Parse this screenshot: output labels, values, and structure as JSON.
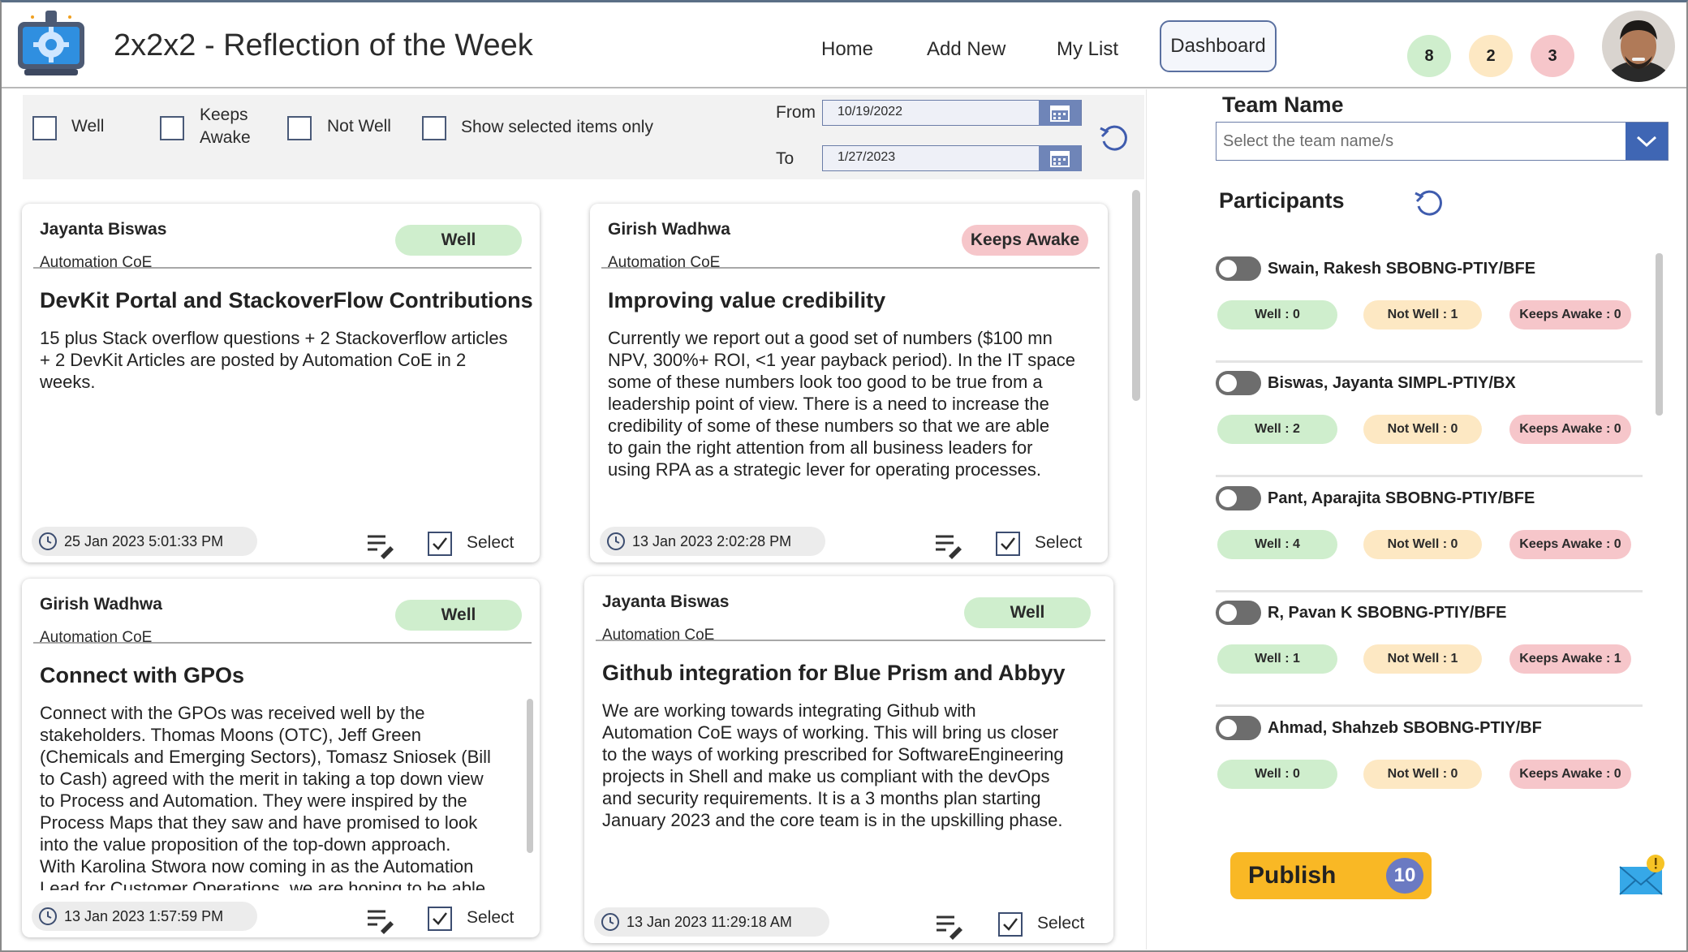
{
  "header": {
    "title": "2x2x2 - Reflection of the Week",
    "nav": [
      "Home",
      "Add New",
      "My List",
      "Dashboard"
    ],
    "counts": [
      {
        "value": "8",
        "color": "#cfeecd"
      },
      {
        "value": "2",
        "color": "#fde8c3"
      },
      {
        "value": "3",
        "color": "#f6c6ca"
      }
    ]
  },
  "filters": {
    "well": "Well",
    "keeps_awake_1": "Keeps",
    "keeps_awake_2": "Awake",
    "not_well": "Not Well",
    "show_selected": "Show selected items only",
    "from_label": "From",
    "to_label": "To",
    "from_date": "10/19/2022",
    "to_date": "1/27/2023"
  },
  "cards": [
    {
      "name": "Jayanta Biswas",
      "org": "Automation CoE",
      "status": "Well",
      "title": "DevKit Portal and StackoverFlow Contributions",
      "body": [
        "15 plus Stack overflow questions + 2 Stackoverflow articles",
        "+ 2 DevKit Articles are posted by Automation CoE in 2",
        "weeks."
      ],
      "timestamp": "25 Jan 2023 5:01:33 PM",
      "select": "Select"
    },
    {
      "name": "Girish Wadhwa",
      "org": "Automation CoE",
      "status": "Keeps Awake",
      "title": "Improving value credibility",
      "body": [
        "Currently we report out a good set of numbers ($100 mn",
        "NPV, 300%+ ROI, <1 year payback period). In the IT space",
        "some of these numbers look too good to be true from a",
        "leadership point of view. There is a need to increase the",
        "credibility of some of these numbers so that we are able",
        "to gain the right attention from all business leaders for",
        "using RPA as a strategic lever for operating processes."
      ],
      "timestamp": "13 Jan 2023 2:02:28 PM",
      "select": "Select"
    },
    {
      "name": "Girish Wadhwa",
      "org": "Automation CoE",
      "status": "Well",
      "title": "Connect with GPOs",
      "body": [
        "Connect with the GPOs was received well by the",
        "stakeholders. Thomas Moons (OTC), Jeff Green",
        "(Chemicals and Emerging Sectors), Tomasz Sniosek (Bill",
        "to Cash) agreed with the merit in taking a top down view",
        "to Process and Automation. They were inspired by the",
        "Process Maps that they saw and have promised to look",
        "into the value proposition of the top-down approach.",
        "With Karolina Stwora now coming in as the Automation",
        "Lead for Customer Operations, we are hoping to be able"
      ],
      "timestamp": "13 Jan 2023 1:57:59 PM",
      "select": "Select"
    },
    {
      "name": "Jayanta Biswas",
      "org": "Automation CoE",
      "status": "Well",
      "title": "Github integration for Blue Prism and Abbyy",
      "body": [
        "We are working towards integrating Github with",
        "Automation CoE ways of working. This will bring us closer",
        "to the ways of working prescribed for SoftwareEngineering",
        "projects in Shell and make us compliant with the devOps",
        "and security requirements. It is a 3 months plan starting",
        "January 2023 and the core team is in the upskilling phase."
      ],
      "timestamp": "13 Jan 2023 11:29:18 AM",
      "select": "Select"
    }
  ],
  "team": {
    "label": "Team Name",
    "placeholder": "Select the team name/s"
  },
  "participants_label": "Participants",
  "participants": [
    {
      "name": "Swain, Rakesh SBOBNG-PTIY/BFE",
      "well": "Well : 0",
      "not_well": "Not Well : 1",
      "keeps_awake": "Keeps Awake : 0"
    },
    {
      "name": "Biswas, Jayanta SIMPL-PTIY/BX",
      "well": "Well : 2",
      "not_well": "Not Well : 0",
      "keeps_awake": "Keeps Awake : 0"
    },
    {
      "name": "Pant, Aparajita SBOBNG-PTIY/BFE",
      "well": "Well : 4",
      "not_well": "Not Well : 0",
      "keeps_awake": "Keeps Awake : 0"
    },
    {
      "name": "R, Pavan K SBOBNG-PTIY/BFE",
      "well": "Well : 1",
      "not_well": "Not Well : 1",
      "keeps_awake": "Keeps Awake : 1"
    },
    {
      "name": "Ahmad, Shahzeb SBOBNG-PTIY/BF",
      "well": "Well : 0",
      "not_well": "Not Well : 0",
      "keeps_awake": "Keeps Awake : 0"
    }
  ],
  "publish": {
    "label": "Publish",
    "count": "10"
  }
}
